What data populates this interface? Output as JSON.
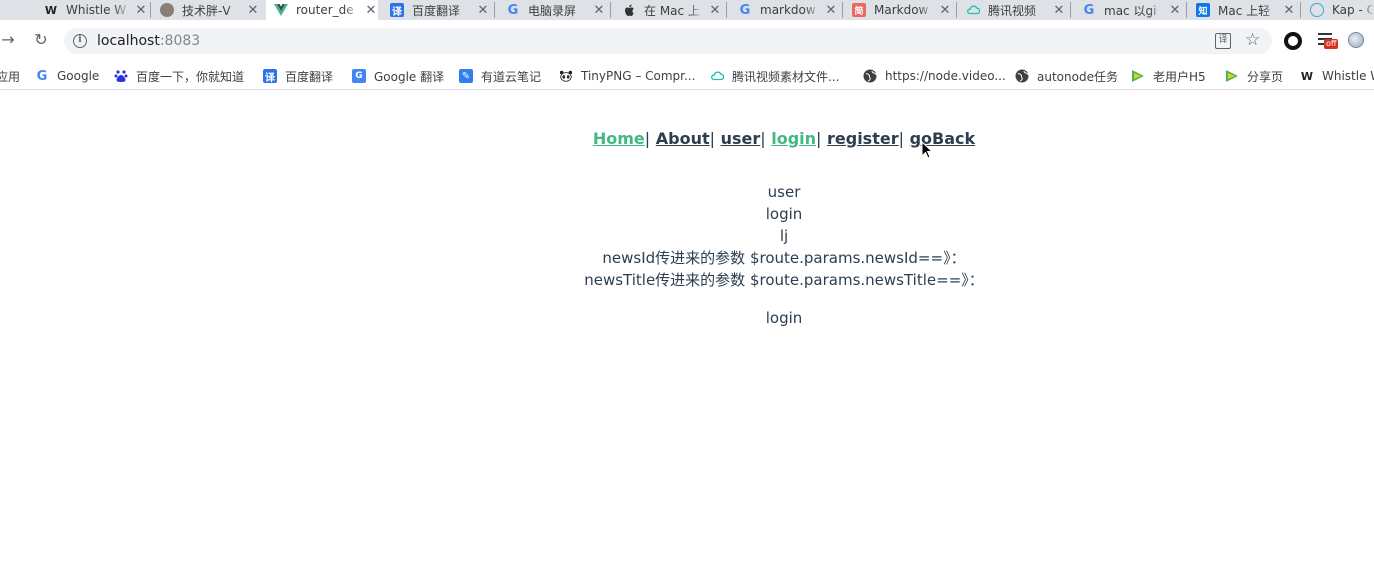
{
  "tabs": [
    {
      "title": "Whistle W",
      "icon": "whistle-icon"
    },
    {
      "title": "技术胖-V",
      "icon": "avatar-icon"
    },
    {
      "title": "router_de",
      "icon": "vue-icon",
      "active": true
    },
    {
      "title": "百度翻译",
      "icon": "translate-icon"
    },
    {
      "title": "电脑录屏",
      "icon": "google-icon"
    },
    {
      "title": "在 Mac 上",
      "icon": "apple-icon"
    },
    {
      "title": "markdow",
      "icon": "google-icon"
    },
    {
      "title": "Markdow",
      "icon": "jianshu-icon"
    },
    {
      "title": "腾讯视频",
      "icon": "cloud-icon"
    },
    {
      "title": "mac 以gi",
      "icon": "google-icon"
    },
    {
      "title": "Mac 上轻",
      "icon": "zhihu-icon"
    },
    {
      "title": "Kap - C",
      "icon": "kap-icon"
    }
  ],
  "address": {
    "host": "localhost",
    "port": ":8083"
  },
  "bookmarks": [
    {
      "label": "应用",
      "icon": "apps-icon"
    },
    {
      "label": "Google",
      "icon": "google-icon"
    },
    {
      "label": "百度一下，你就知道",
      "icon": "baidu-icon"
    },
    {
      "label": "百度翻译",
      "icon": "translate-icon"
    },
    {
      "label": "Google 翻译",
      "icon": "google-translate-icon"
    },
    {
      "label": "有道云笔记",
      "icon": "youdao-icon"
    },
    {
      "label": "TinyPNG – Compr...",
      "icon": "panda-icon"
    },
    {
      "label": "腾讯视频素材文件...",
      "icon": "cloud-icon"
    },
    {
      "label": "https://node.video...",
      "icon": "globe-icon"
    },
    {
      "label": "autonode任务",
      "icon": "globe-icon"
    },
    {
      "label": "老用户H5",
      "icon": "play-icon"
    },
    {
      "label": "分享页",
      "icon": "play-icon"
    },
    {
      "label": "Whistle W",
      "icon": "whistle-icon"
    }
  ],
  "nav": {
    "home": "Home",
    "about": "About",
    "user": "user",
    "login": "login",
    "register": "register",
    "goback": "goBack",
    "separator": "|"
  },
  "content": {
    "line1": "user",
    "line2": "login",
    "line3": "lj",
    "line4": "newsId传进来的参数 $route.params.newsId==》：",
    "line5": "newsTitle传进来的参数 $route.params.newsTitle==》：",
    "child": "login"
  },
  "colors": {
    "active_link": "#42b983",
    "text": "#2c3e50",
    "tabstrip": "#dee1e6"
  }
}
